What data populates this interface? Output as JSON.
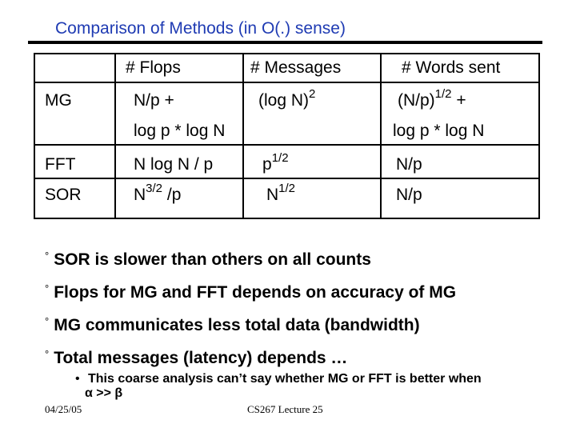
{
  "title": "Comparison of Methods (in O(.) sense)",
  "table": {
    "headers": [
      "",
      "# Flops",
      "# Messages",
      "# Words sent"
    ],
    "rows": [
      {
        "method": "MG",
        "flops_line1": "N/p +",
        "flops_line2": "log p * log N",
        "messages_base": "(log N)",
        "messages_sup": "2",
        "words_base": "(N/p)",
        "words_sup": "1/2",
        "words_tail": " +",
        "words_line2": "log p * log N"
      },
      {
        "method": "FFT",
        "flops": "N log N / p",
        "messages_base": "p",
        "messages_sup": "1/2",
        "words": "N/p"
      },
      {
        "method": "SOR",
        "flops_base": "N",
        "flops_sup": "3/2",
        "flops_tail": " /p",
        "messages_base": "N",
        "messages_sup": "1/2",
        "words": "N/p"
      }
    ]
  },
  "bullets": [
    {
      "marker": "°",
      "text": "SOR is slower than others on all counts"
    },
    {
      "marker": "°",
      "text": "Flops for MG and FFT depends on accuracy of MG"
    },
    {
      "marker": "°",
      "text": "MG communicates less total data (bandwidth)"
    },
    {
      "marker": "°",
      "text": "Total messages (latency) depends …"
    }
  ],
  "sub_bullet": {
    "marker": "•",
    "line1": "This coarse analysis can’t say whether MG or FFT is better when",
    "line2": "α >> β"
  },
  "footer": {
    "date": "04/25/05",
    "lecture": "CS267 Lecture 25"
  },
  "colors": {
    "title": "#1f3bb3",
    "text": "#000000",
    "background": "#ffffff"
  }
}
